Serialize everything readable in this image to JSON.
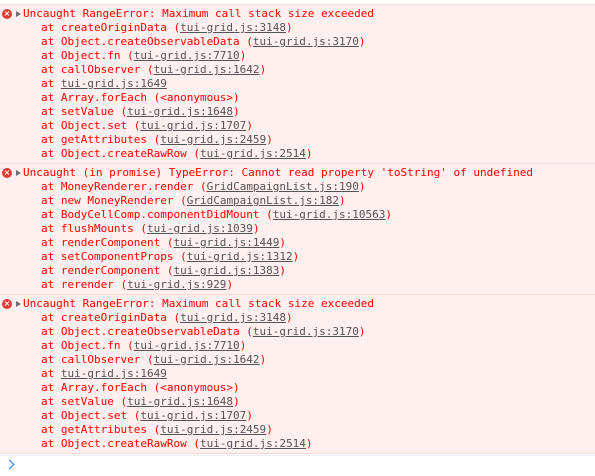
{
  "errors": [
    {
      "header": "Uncaught RangeError: Maximum call stack size exceeded",
      "frames": [
        {
          "prefix": "at createOriginData (",
          "loc": "tui-grid.js:3148",
          "suffix": ")"
        },
        {
          "prefix": "at Object.createObservableData (",
          "loc": "tui-grid.js:3170",
          "suffix": ")"
        },
        {
          "prefix": "at Object.fn (",
          "loc": "tui-grid.js:7710",
          "suffix": ")"
        },
        {
          "prefix": "at callObserver (",
          "loc": "tui-grid.js:1642",
          "suffix": ")"
        },
        {
          "prefix": "at ",
          "loc": "tui-grid.js:1649",
          "suffix": ""
        },
        {
          "prefix": "at Array.forEach (<anonymous>)",
          "loc": "",
          "suffix": ""
        },
        {
          "prefix": "at setValue (",
          "loc": "tui-grid.js:1648",
          "suffix": ")"
        },
        {
          "prefix": "at Object.set (",
          "loc": "tui-grid.js:1707",
          "suffix": ")"
        },
        {
          "prefix": "at getAttributes (",
          "loc": "tui-grid.js:2459",
          "suffix": ")"
        },
        {
          "prefix": "at Object.createRawRow (",
          "loc": "tui-grid.js:2514",
          "suffix": ")"
        }
      ]
    },
    {
      "header": "Uncaught (in promise) TypeError: Cannot read property 'toString' of undefined",
      "frames": [
        {
          "prefix": "at MoneyRenderer.render (",
          "loc": "GridCampaignList.js:190",
          "suffix": ")"
        },
        {
          "prefix": "at new MoneyRenderer (",
          "loc": "GridCampaignList.js:182",
          "suffix": ")"
        },
        {
          "prefix": "at BodyCellComp.componentDidMount (",
          "loc": "tui-grid.js:10563",
          "suffix": ")"
        },
        {
          "prefix": "at flushMounts (",
          "loc": "tui-grid.js:1039",
          "suffix": ")"
        },
        {
          "prefix": "at renderComponent (",
          "loc": "tui-grid.js:1449",
          "suffix": ")"
        },
        {
          "prefix": "at setComponentProps (",
          "loc": "tui-grid.js:1312",
          "suffix": ")"
        },
        {
          "prefix": "at renderComponent (",
          "loc": "tui-grid.js:1383",
          "suffix": ")"
        },
        {
          "prefix": "at rerender (",
          "loc": "tui-grid.js:929",
          "suffix": ")"
        }
      ]
    },
    {
      "header": "Uncaught RangeError: Maximum call stack size exceeded",
      "frames": [
        {
          "prefix": "at createOriginData (",
          "loc": "tui-grid.js:3148",
          "suffix": ")"
        },
        {
          "prefix": "at Object.createObservableData (",
          "loc": "tui-grid.js:3170",
          "suffix": ")"
        },
        {
          "prefix": "at Object.fn (",
          "loc": "tui-grid.js:7710",
          "suffix": ")"
        },
        {
          "prefix": "at callObserver (",
          "loc": "tui-grid.js:1642",
          "suffix": ")"
        },
        {
          "prefix": "at ",
          "loc": "tui-grid.js:1649",
          "suffix": ""
        },
        {
          "prefix": "at Array.forEach (<anonymous>)",
          "loc": "",
          "suffix": ""
        },
        {
          "prefix": "at setValue (",
          "loc": "tui-grid.js:1648",
          "suffix": ")"
        },
        {
          "prefix": "at Object.set (",
          "loc": "tui-grid.js:1707",
          "suffix": ")"
        },
        {
          "prefix": "at getAttributes (",
          "loc": "tui-grid.js:2459",
          "suffix": ")"
        },
        {
          "prefix": "at Object.createRawRow (",
          "loc": "tui-grid.js:2514",
          "suffix": ")"
        }
      ]
    }
  ],
  "colors": {
    "error_text": "#ff0000",
    "error_background": "#fff0f0",
    "error_border": "#fed6d6",
    "link_text": "#545454",
    "prompt_accent": "#1a73e8"
  },
  "icons": {
    "error": "error-circle-icon",
    "expand": "disclosure-triangle-icon",
    "prompt": "prompt-chevron-icon"
  }
}
